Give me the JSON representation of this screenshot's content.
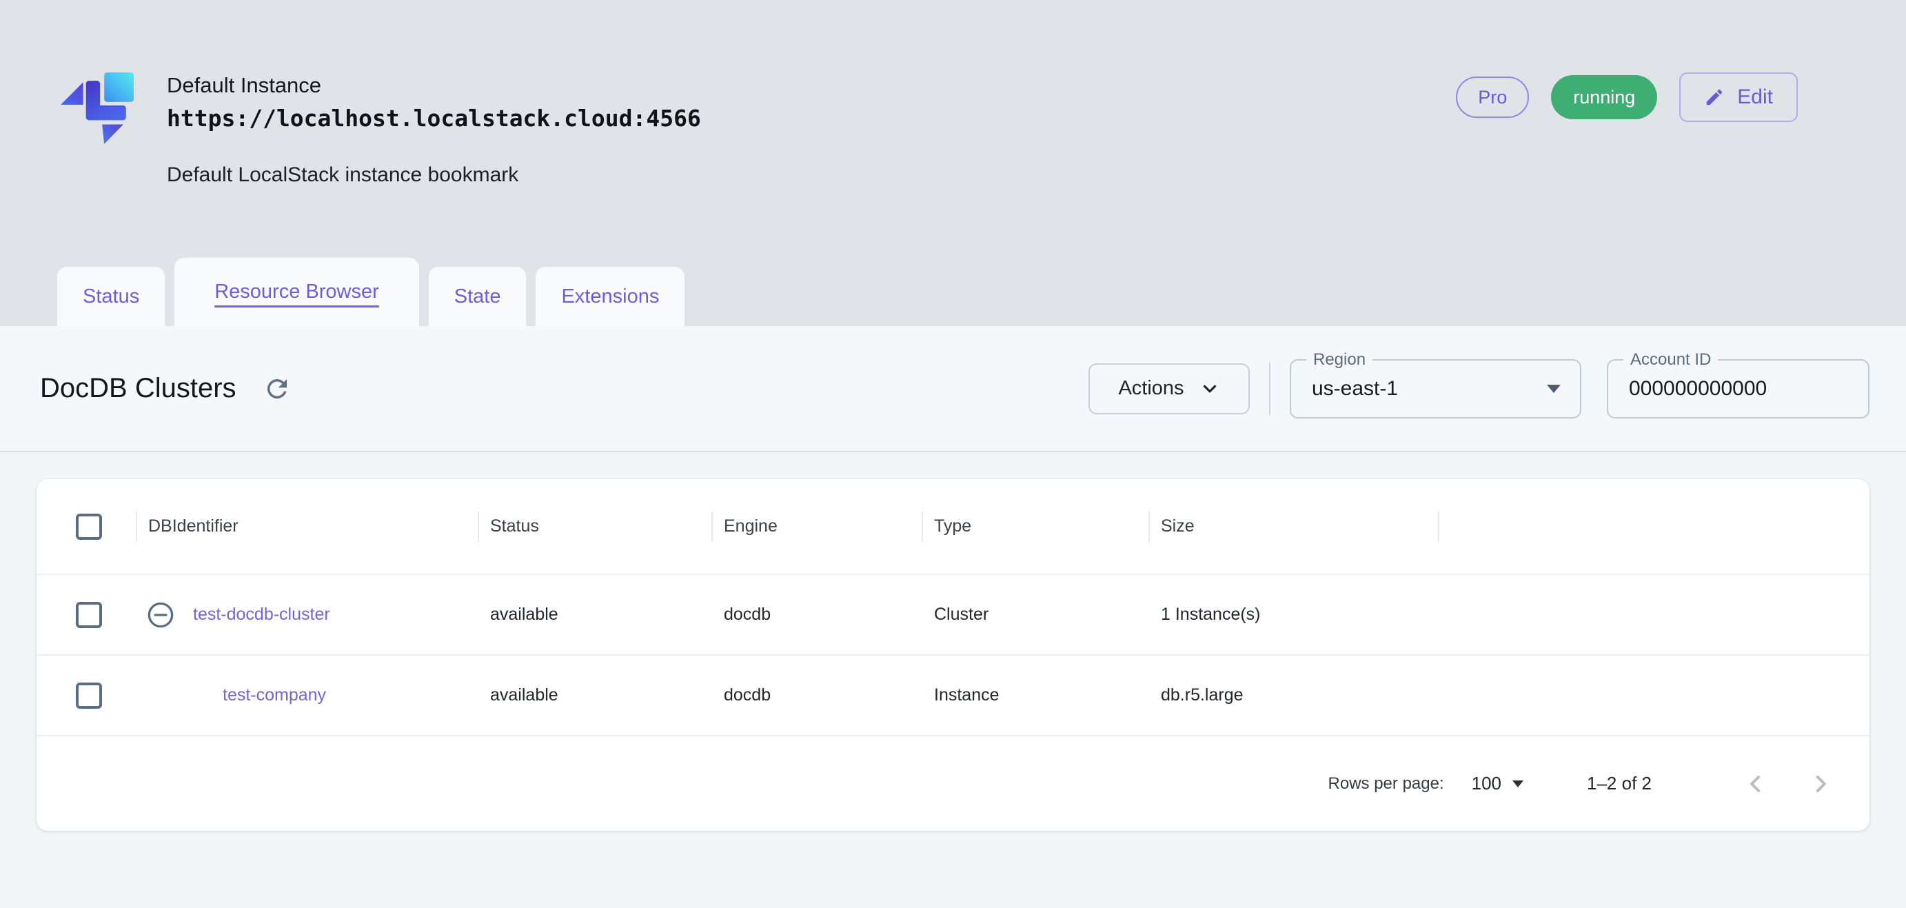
{
  "header": {
    "title": "Default Instance",
    "url": "https://localhost.localstack.cloud:4566",
    "subtitle": "Default LocalStack instance bookmark",
    "plan_badge": "Pro",
    "status_badge": "running",
    "edit_label": "Edit"
  },
  "tabs": [
    {
      "label": "Status"
    },
    {
      "label": "Resource Browser"
    },
    {
      "label": "State"
    },
    {
      "label": "Extensions"
    }
  ],
  "toolbar": {
    "page_title": "DocDB Clusters",
    "actions_label": "Actions",
    "region_label": "Region",
    "region_value": "us-east-1",
    "account_label": "Account ID",
    "account_value": "000000000000"
  },
  "table": {
    "columns": [
      "DBIdentifier",
      "Status",
      "Engine",
      "Type",
      "Size"
    ],
    "rows": [
      {
        "id": "test-docdb-cluster",
        "status": "available",
        "engine": "docdb",
        "type": "Cluster",
        "size": "1 Instance(s)"
      },
      {
        "id": "test-company",
        "status": "available",
        "engine": "docdb",
        "type": "Instance",
        "size": "db.r5.large"
      }
    ],
    "pagination": {
      "label": "Rows per page:",
      "value": "100",
      "range": "1–2 of 2"
    }
  },
  "colors": {
    "accent_purple": "#6c5ad2",
    "link_purple": "#7365d5",
    "success_green": "#3fae73",
    "slate_icon": "#5d7183",
    "topbar_bg": "#e0e3e8",
    "band_bg": "#f5f8fa"
  },
  "icons": {
    "refresh": "↻",
    "edit": "✎",
    "actions_chevron": "⌄",
    "select_arrow": "▾",
    "expand_row": "⊖",
    "prev_page": "‹",
    "next_page": "›"
  }
}
